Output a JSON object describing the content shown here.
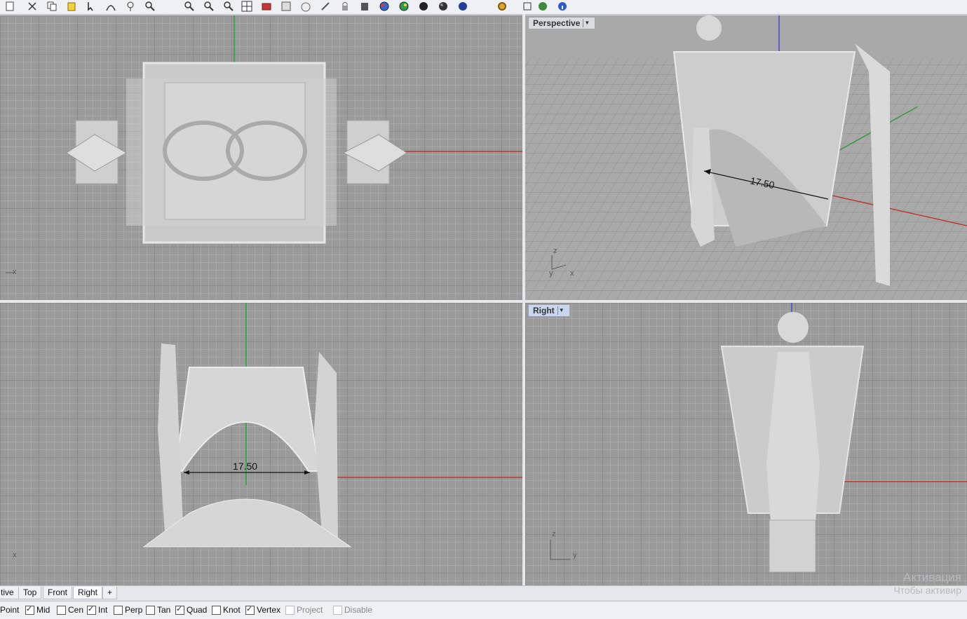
{
  "toolbar": {
    "icons": [
      "new-icon",
      "scissors-icon",
      "copy-icon",
      "paste-icon",
      "arrow-icon",
      "curve-icon",
      "pin-icon",
      "zoom-icon",
      "zoom-window-icon",
      "zoom-extents-icon",
      "zoom-selected-icon",
      "four-view-icon",
      "render-icon",
      "properties-icon",
      "sphere-icon",
      "paint-icon",
      "lock-icon",
      "shade-icon",
      "render-globe-icon",
      "material-icon",
      "dark-sphere-icon",
      "blue-sphere-icon",
      "gear-icon",
      "layer-icon",
      "globe-icon",
      "info-icon"
    ]
  },
  "viewports": {
    "top": {
      "axis": "x"
    },
    "perspective": {
      "label": "Perspective",
      "axis_z": "z",
      "axis_x": "x",
      "axis_y": "y",
      "dimension": "17.50"
    },
    "front": {
      "axis": "x",
      "dimension": "17.50"
    },
    "right": {
      "label": "Right",
      "axis_z": "z",
      "axis_y": "y"
    }
  },
  "tabs": [
    "tive",
    "Top",
    "Front",
    "Right",
    "+"
  ],
  "active_tab": "Right",
  "osnaps": [
    {
      "label": "Point",
      "checked": false,
      "partial": true
    },
    {
      "label": "Mid",
      "checked": true
    },
    {
      "label": "Cen",
      "checked": false
    },
    {
      "label": "Int",
      "checked": true
    },
    {
      "label": "Perp",
      "checked": false
    },
    {
      "label": "Tan",
      "checked": false
    },
    {
      "label": "Quad",
      "checked": true
    },
    {
      "label": "Knot",
      "checked": false
    },
    {
      "label": "Vertex",
      "checked": true
    },
    {
      "label": "Project",
      "checked": false,
      "disabled": true
    },
    {
      "label": "Disable",
      "checked": false,
      "disabled": true
    }
  ],
  "watermark": {
    "line1": "Активация",
    "line2": "Чтобы активир"
  },
  "colors": {
    "grid_bg": "#9a9a9a",
    "axis_x": "#c0392b",
    "axis_y": "#2e9e3a",
    "axis_z": "#4a4ad0",
    "model": "#d9d9d9"
  }
}
